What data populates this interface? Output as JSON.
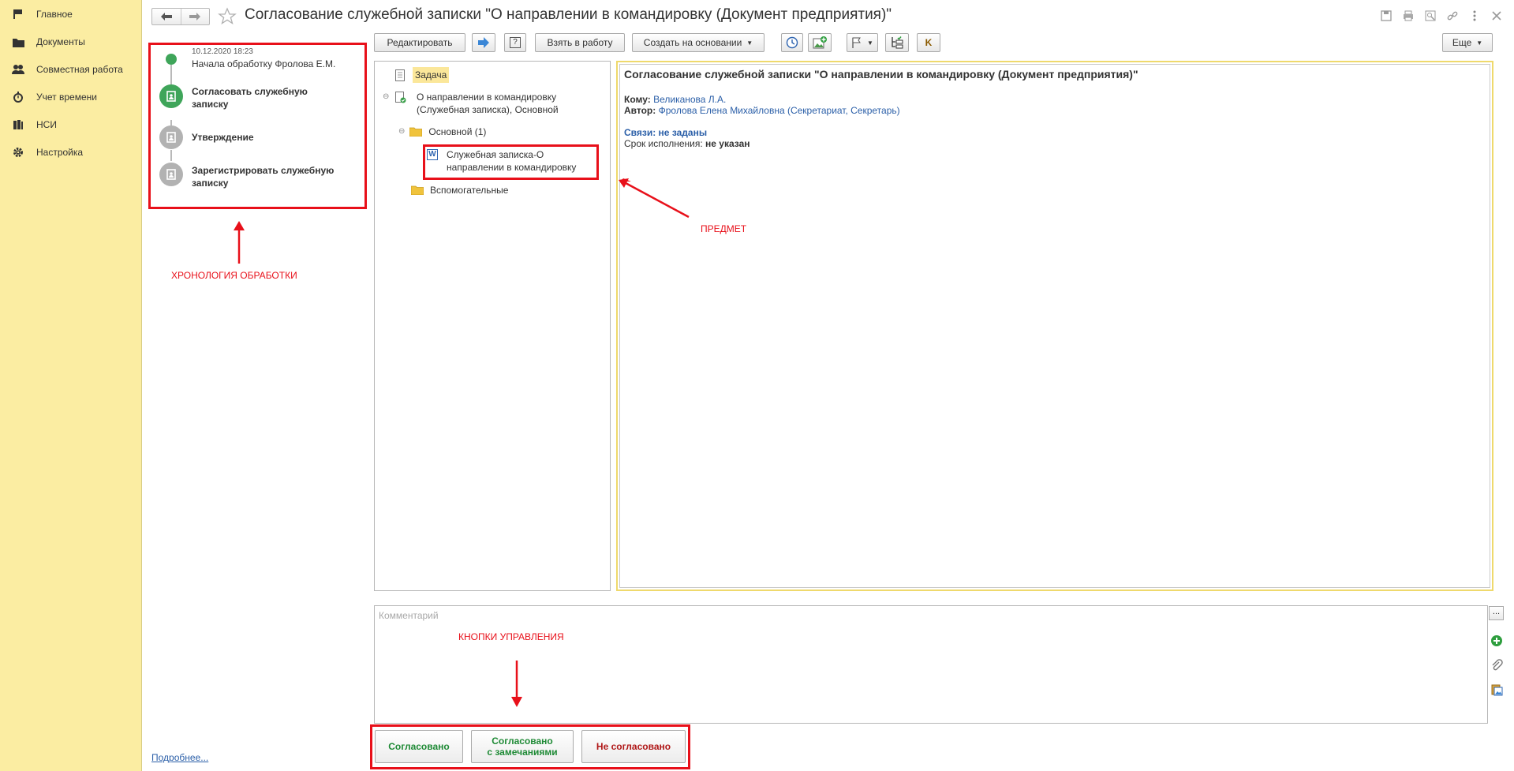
{
  "sidebar": {
    "items": [
      {
        "label": "Главное",
        "icon": "home-flag-icon"
      },
      {
        "label": "Документы",
        "icon": "folder-icon"
      },
      {
        "label": "Совместная работа",
        "icon": "users-icon"
      },
      {
        "label": "Учет времени",
        "icon": "stopwatch-icon"
      },
      {
        "label": "НСИ",
        "icon": "books-icon"
      },
      {
        "label": "Настройка",
        "icon": "gear-icon"
      }
    ]
  },
  "header": {
    "title": "Согласование служебной записки \"О направлении в командировку (Документ предприятия)\""
  },
  "toolbar": {
    "edit": "Редактировать",
    "help": "?",
    "take": "Взять в работу",
    "create_based": "Создать на основании",
    "k": "K",
    "more": "Еще"
  },
  "timeline": {
    "date": "10.12.2020 18:23",
    "start": "Начала обработку Фролова Е.М.",
    "steps": [
      {
        "line1": "Согласовать служебную",
        "line2": "записку",
        "state": "active"
      },
      {
        "line1": "Утверждение",
        "line2": "",
        "state": "pending"
      },
      {
        "line1": "Зарегистрировать служебную",
        "line2": "записку",
        "state": "pending"
      }
    ],
    "more_link": "Подробнее..."
  },
  "tree": {
    "task": "Задача",
    "doc_line1": "О направлении в командировку",
    "doc_line2": "(Служебная записка), Основной",
    "folder_main": "Основной (1)",
    "file_line1": "Служебная записка-О",
    "file_line2": "направлении в командировку",
    "folder_aux": "Вспомогательные"
  },
  "preview": {
    "title": "Согласование служебной записки \"О направлении в командировку (Документ предприятия)\"",
    "to_label": "Кому:",
    "to_value": "Великанова Л.А.",
    "author_label": "Автор:",
    "author_value": "Фролова Елена Михайловна (Секретариат, Секретарь)",
    "links": "Связи: не заданы",
    "deadline_label": "Срок исполнения:",
    "deadline_value": "не указан"
  },
  "comment": {
    "placeholder": "Комментарий",
    "ellipsis": "..."
  },
  "actions": {
    "agreed": "Согласовано",
    "agreed_remarks_1": "Согласовано",
    "agreed_remarks_2": "с замечаниями",
    "not_agreed": "Не согласовано"
  },
  "annotations": {
    "history": "ХРОНОЛОГИЯ ОБРАБОТКИ",
    "subject": "ПРЕДМЕТ",
    "controls": "КНОПКИ УПРАВЛЕНИЯ"
  },
  "colors": {
    "sidebar_bg": "#fbeda2",
    "accent_green": "#3fa55a",
    "link_blue": "#2b5fa8",
    "annotation_red": "#e8101a",
    "agreed_green": "#1e8a35",
    "not_agreed_red": "#b01818"
  }
}
